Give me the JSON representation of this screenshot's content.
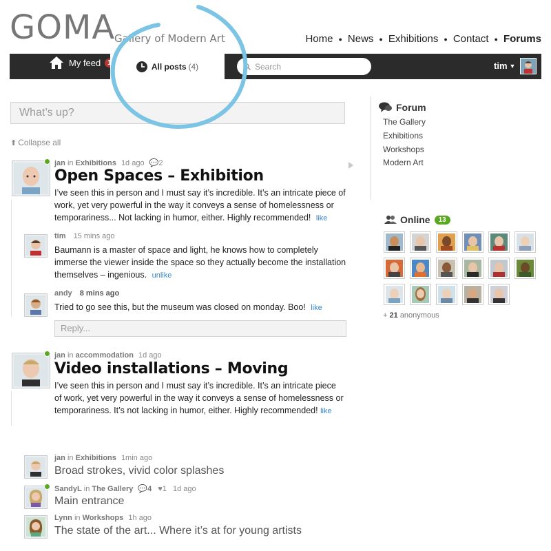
{
  "header": {
    "logo": "GOMA",
    "subtitle": "Gallery of Modern Art",
    "nav": [
      "Home",
      "News",
      "Exhibitions",
      "Contact",
      "Forums"
    ]
  },
  "toolbar": {
    "my_feed_label": "My feed",
    "my_feed_count": "13",
    "all_posts_label": "All posts",
    "all_posts_count": "(4)",
    "search_placeholder": "Search",
    "user_name": "tim"
  },
  "composer": {
    "placeholder": "What’s up?"
  },
  "collapse_all": "Collapse all",
  "posts": [
    {
      "author": "jan",
      "in": "in",
      "category": "Exhibitions",
      "time": "1d ago",
      "comments": "2",
      "title": "Open Spaces – Exhibition",
      "body": "I’ve seen this in person and I must say it’s incredible. It’s an intricate piece of work, yet very powerful in the way it conveys a sense of homelessness or temporariness... Not lacking in humor, either. Highly recommended!",
      "like": "like",
      "replies": [
        {
          "author": "tim",
          "time": "15 mins ago",
          "body": "Baumann is a master of space and light, he knows how to completely immerse the viewer inside the space so they actually become the installation themselves – ingenious.",
          "like": "unlike"
        },
        {
          "author": "andy",
          "time": "8 mins ago",
          "body": "Tried to go see this, but the museum was closed on monday. Boo!",
          "like": "like"
        }
      ],
      "reply_placeholder": "Reply..."
    },
    {
      "author": "jan",
      "in": "in",
      "category": "accommodation",
      "time": "1d ago",
      "title": "Video installations – Moving",
      "body": "I’ve seen this in person and I must say it’s incredible. It’s an intricate piece of work, yet very powerful in the way it conveys a sense of homelessness or temporariness. It’s not lacking in humor, either. Highly recommended!",
      "like": "like"
    }
  ],
  "collapsed_posts": [
    {
      "author": "jan",
      "in": "in",
      "category": "Exhibitions",
      "time": "1min ago",
      "title": "Broad strokes, vivid color splashes"
    },
    {
      "author": "SandyL",
      "in": "in",
      "category": "The Gallery",
      "comments": "4",
      "likes": "1",
      "time": "1d ago",
      "title": "Main entrance"
    },
    {
      "author": "Lynn",
      "in": "in",
      "category": "Workshops",
      "time": "1h ago",
      "title": "The state of the art... Where it’s at for young artists"
    }
  ],
  "sidebar": {
    "forum_title": "Forum",
    "forum_links": [
      "The Gallery",
      "Exhibitions",
      "Workshops",
      "Modern Art"
    ],
    "online_title": "Online",
    "online_count": "13",
    "anon_count": "21",
    "anon_prefix": "+",
    "anon_label": "anonymous"
  },
  "colors": {
    "bar": "#2b2b2b",
    "accent_link": "#3a88c8",
    "badge_red": "#b23a32",
    "badge_green": "#5aa820",
    "annotation_circle": "#7cc4e4"
  }
}
